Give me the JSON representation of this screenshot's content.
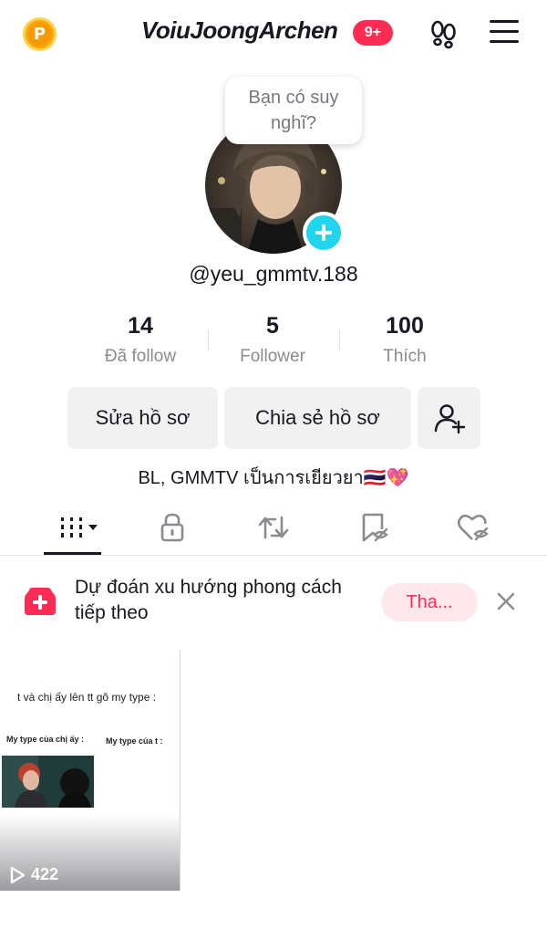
{
  "header": {
    "coin_letter": "P",
    "username": "VoiuJoongArchen",
    "notification_badge": "9+",
    "footprint_icon": "footprints-icon",
    "menu_icon": "hamburger-menu-icon"
  },
  "profile": {
    "thought_bubble": "Bạn có suy nghĩ?",
    "handle": "@yeu_gmmtv.188",
    "stats": [
      {
        "value": "14",
        "label": "Đã follow"
      },
      {
        "value": "5",
        "label": "Follower"
      },
      {
        "value": "100",
        "label": "Thích"
      }
    ],
    "buttons": {
      "edit": "Sửa hồ sơ",
      "share": "Chia sẻ hồ sơ"
    },
    "bio": "BL, GMMTV เป็นการเยียวยา🇹🇭💖"
  },
  "tabs": [
    {
      "name": "videos-grid-icon",
      "active": true
    },
    {
      "name": "private-lock-icon",
      "active": false
    },
    {
      "name": "repost-icon",
      "active": false
    },
    {
      "name": "favorites-icon",
      "active": false
    },
    {
      "name": "liked-icon",
      "active": false
    }
  ],
  "promo": {
    "text": "Dự đoán xu hướng phong cách tiếp theo",
    "button": "Tha...",
    "accent": "#fe2c55"
  },
  "videos": [
    {
      "caption": "t và chị ấy lên tt gõ my type :",
      "label_left": "My type của chị ấy :",
      "label_right": "My type của t :",
      "views": "422"
    }
  ],
  "colors": {
    "brand_red": "#fe2c55",
    "cyan": "#20d5ec",
    "muted_text": "#8a8b91",
    "button_bg": "#f1f1f2"
  }
}
